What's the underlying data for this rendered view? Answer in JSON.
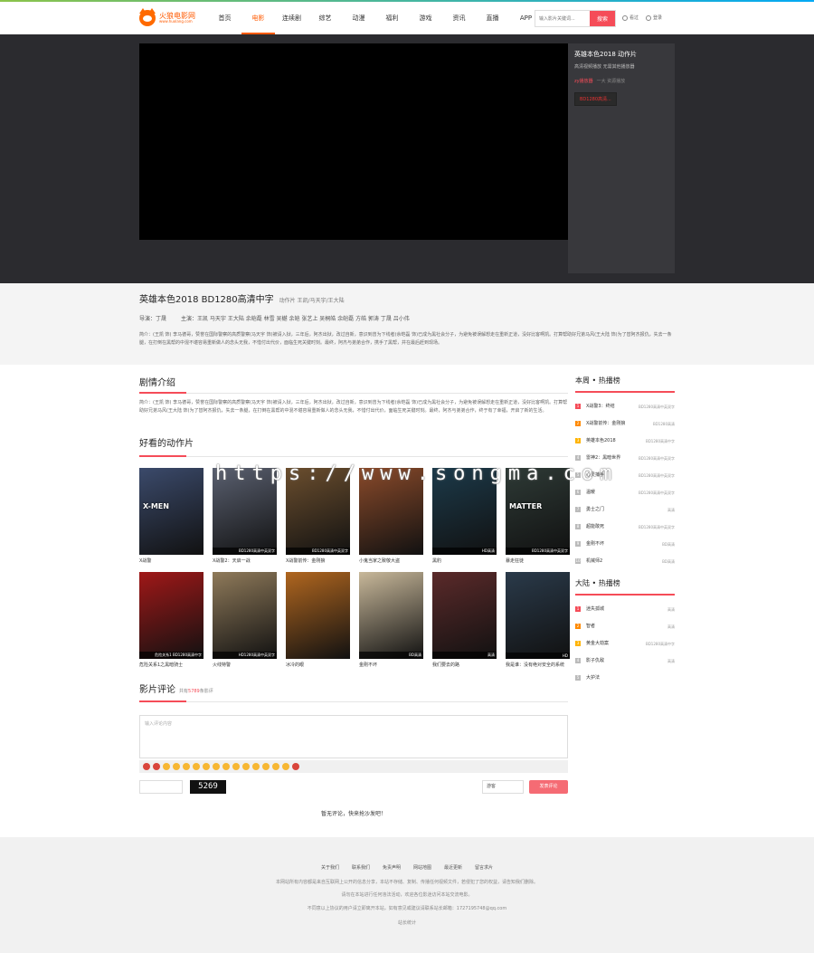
{
  "header": {
    "logo_title": "火狼电影网",
    "logo_sub": "www.huolang.com",
    "nav": [
      "首页",
      "电影",
      "连续剧",
      "综艺",
      "动漫",
      "福利",
      "游戏",
      "资讯",
      "直播",
      "APP"
    ],
    "search_placeholder": "输入影片关键词...",
    "search_button": "搜索",
    "history": "看过",
    "login": "登录"
  },
  "player": {
    "side_title": "英雄本色2018 动作片",
    "side_sub": "高清视频播放 无需其他播放器",
    "source_name": "zy播放器",
    "source_note": "一大 资源播放",
    "episode": "BD1280高清..."
  },
  "info": {
    "title": "英雄本色2018 BD1280高清中字",
    "tags": "动作片 王凯/马天宇/王大陆",
    "director": "导演：丁晟",
    "actors": "主演：王凯 马天宇 王大陆 余皑磊 林雪 吴樾 余皑 张艺上 吴桐皓 余皑磊 方皓 郭涛 丁晟 吕小伟",
    "desc": "简介：(王凯 饰) 李马德哥，赞誉在国际警察的高质警察(马天宇 饰)被请入狱，三年后，阿杰出狱，改过自新，意识到曾为下线者(余皑磊 饰)已成为黑社会分子，为避免被误解想走在重新正道，没好比客啊凯。打算帮助好兄弟马风(王大陆 饰)为了替阿杰报仇，失去一条腿，在打倒在黑帮的中混不堪容易重新做人的念头无我，不惜付出代价，面临生死关键时刻。最终，阿杰与弟弟合作，携手了黑帮，并在最后赶到现场。"
  },
  "plot": {
    "heading": "剧情介绍",
    "text": "简介：(王凯 饰) 李马德哥，赞誉在国际警察的高质警察(马天宇 饰)被请入狱，三年后，阿杰出狱，改过自新，意识到曾为下线者(余皑磊 饰)已成为黑社会分子，为避免被误解想走在重新正道，没好比客啊凯。打算帮助好兄弟马风(王大陆 饰)为了替阿杰报仇，失去一条腿，在打倒在黑帮的中混不堪容易重新做人的念头无我，不惜付出代价，面临生死关键时刻。最终，阿杰与弟弟合作，终于有了幸福，开启了新的生活。"
  },
  "related": {
    "heading": "好看的动作片",
    "items": [
      {
        "name": "X战警",
        "cap": "",
        "big": "X-MEN",
        "color": "#3b4a6b"
      },
      {
        "name": "X战警2：天启一战",
        "cap": "BD1280高清中英双字",
        "big": "",
        "color": "#5a6070"
      },
      {
        "name": "X战警前传：金刚狼",
        "cap": "BD1280高清中英双字",
        "big": "",
        "color": "#6b4e2e"
      },
      {
        "name": "小鬼当家之致敬大盗",
        "cap": "",
        "big": "",
        "color": "#8a4a2a"
      },
      {
        "name": "黑豹",
        "cap": "HD高清",
        "big": "",
        "color": "#1c3a4a"
      },
      {
        "name": "暴走狂徒",
        "cap": "BD1280高清中英双字",
        "big": "MATTER",
        "color": "#2e3a36"
      },
      {
        "name": "危险关系1之黑暗骑士",
        "cap": "危险关系1 BD1280高清中字",
        "big": "",
        "color": "#a01818"
      },
      {
        "name": "火线特警",
        "cap": "HD1280高清中英双字",
        "big": "",
        "color": "#8f7a5a"
      },
      {
        "name": "冰冷的眼",
        "cap": "",
        "big": "",
        "color": "#b0661f"
      },
      {
        "name": "金刚不坏",
        "cap": "BD高清",
        "big": "",
        "color": "#c8b89a"
      },
      {
        "name": "我们要去的路",
        "cap": "高清",
        "big": "",
        "color": "#5b2a2a"
      },
      {
        "name": "我是谁：没有绝对安全的系统",
        "cap": "HD",
        "big": "",
        "color": "#2a3a4a"
      }
    ]
  },
  "watermark": "https://www.songma.com",
  "comments": {
    "heading": "影片评论",
    "count_prefix": "共有",
    "count": "5789",
    "count_suffix": "条影评",
    "placeholder": "输入评论内容",
    "captcha": "5269",
    "guest": "游客",
    "submit": "发表评论",
    "empty": "暂无评论，快来抢沙发吧！"
  },
  "rank_week": {
    "title": "本周 • 热播榜",
    "items": [
      {
        "title": "X战警3：终结",
        "extra": "BD1280高清中英双字"
      },
      {
        "title": "X战警前传：金刚狼",
        "extra": "BD1280高清"
      },
      {
        "title": "英雄本色2018",
        "extra": "BD1280高清中字"
      },
      {
        "title": "雷神2：黑暗世界",
        "extra": "BD1280高清中英双字"
      },
      {
        "title": "心灵捕手",
        "extra": "BD1280高清中英双字"
      },
      {
        "title": "温暖",
        "extra": "BD1280高清中英双字"
      },
      {
        "title": "勇士之门",
        "extra": "高清"
      },
      {
        "title": "超能敢死",
        "extra": "BD1280高清中英双字"
      },
      {
        "title": "金刚不坏",
        "extra": "BD高清"
      },
      {
        "title": "机械师2",
        "extra": "BD高清"
      }
    ]
  },
  "rank_mainland": {
    "title": "大陆 • 热播榜",
    "items": [
      {
        "title": "迷失孤城",
        "extra": "高清"
      },
      {
        "title": "智者",
        "extra": "高清"
      },
      {
        "title": "黄金大劫案",
        "extra": "BD1280高清中字"
      },
      {
        "title": "影子仇敌",
        "extra": "高清"
      },
      {
        "title": "大护法",
        "extra": ""
      }
    ]
  },
  "footer": {
    "links": [
      "关于我们",
      "联系我们",
      "免责声明",
      "网站地图",
      "最近更新",
      "留言求片"
    ],
    "line1": "本网站所有内容都是来自互联网上公开的信息分享，本站不存储、复制、传播任何视频文件，若侵犯了您的权益，请告知我们删除。",
    "line2": "请勿在本站进行任何违法活动，欢迎各位影迷访问本站交流电影。",
    "line3": "不同意以上协议的用户请立即离开本站，如有意见或建议请联系站长邮箱：1727195748@qq.com",
    "stat": "站长统计"
  }
}
